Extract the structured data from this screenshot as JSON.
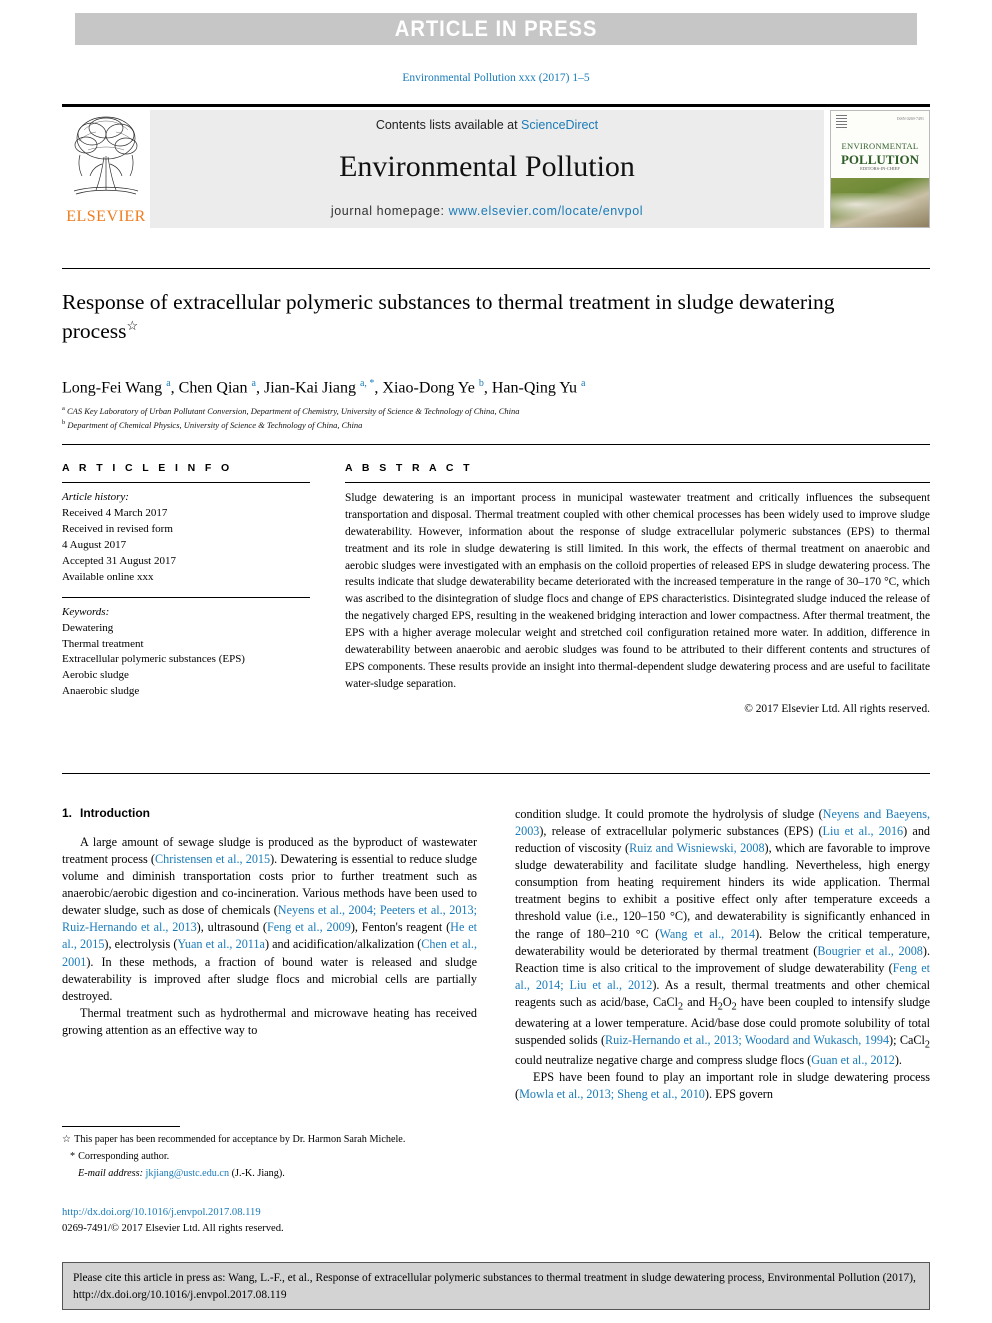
{
  "banner": {
    "text": "ARTICLE IN PRESS"
  },
  "running_head": "Environmental Pollution xxx (2017) 1–5",
  "masthead": {
    "contents_prefix": "Contents lists available at ",
    "contents_link": "ScienceDirect",
    "journal_name": "Environmental Pollution",
    "homepage_label": "journal homepage: ",
    "homepage_url": "www.elsevier.com/locate/envpol",
    "publisher_logo_text": "ELSEVIER",
    "cover": {
      "title_line1": "ENVIRONMENTAL",
      "title_line2": "POLLUTION",
      "subtitle": "EDITORS-IN-CHIEF",
      "issn": "ISSN 0269-7491"
    }
  },
  "article": {
    "title": "Response of extracellular polymeric substances to thermal treatment in sludge dewatering process",
    "title_footnote_marker": "☆",
    "authors_html": "Long-Fei Wang <sup>a</sup>, Chen Qian <sup>a</sup>, Jian-Kai Jiang <sup>a, *</sup>, Xiao-Dong Ye <sup>b</sup>, Han-Qing Yu <sup>a</sup>",
    "affiliations": [
      {
        "marker": "a",
        "text": "CAS Key Laboratory of Urban Pollutant Conversion, Department of Chemistry, University of Science & Technology of China, China"
      },
      {
        "marker": "b",
        "text": "Department of Chemical Physics, University of Science & Technology of China, China"
      }
    ]
  },
  "article_info": {
    "heading": "A R T I C L E   I N F O",
    "history_label": "Article history:",
    "history": [
      "Received 4 March 2017",
      "Received in revised form",
      "4 August 2017",
      "Accepted 31 August 2017",
      "Available online xxx"
    ],
    "keywords_label": "Keywords:",
    "keywords": [
      "Dewatering",
      "Thermal treatment",
      "Extracellular polymeric substances (EPS)",
      "Aerobic sludge",
      "Anaerobic sludge"
    ]
  },
  "abstract": {
    "heading": "A B S T R A C T",
    "text": "Sludge dewatering is an important process in municipal wastewater treatment and critically influences the subsequent transportation and disposal. Thermal treatment coupled with other chemical processes has been widely used to improve sludge dewaterability. However, information about the response of sludge extracellular polymeric substances (EPS) to thermal treatment and its role in sludge dewatering is still limited. In this work, the effects of thermal treatment on anaerobic and aerobic sludges were investigated with an emphasis on the colloid properties of released EPS in sludge dewatering process. The results indicate that sludge dewaterability became deteriorated with the increased temperature in the range of 30–170 °C, which was ascribed to the disintegration of sludge flocs and change of EPS characteristics. Disintegrated sludge induced the release of the negatively charged EPS, resulting in the weakened bridging interaction and lower compactness. After thermal treatment, the EPS with a higher average molecular weight and stretched coil configuration retained more water. In addition, difference in dewaterability between anaerobic and aerobic sludges was found to be attributed to their different contents and structures of EPS components. These results provide an insight into thermal-dependent sludge dewatering process and are useful to facilitate water-sludge separation.",
    "copyright": "© 2017 Elsevier Ltd. All rights reserved."
  },
  "body": {
    "section_number": "1.",
    "section_title": "Introduction",
    "left_paragraphs_html": [
      "A large amount of sewage sludge is produced as the byproduct of wastewater treatment process (<span class=\"cite\">Christensen et al., 2015</span>). Dewatering is essential to reduce sludge volume and diminish transportation costs prior to further treatment such as anaerobic/aerobic digestion and co-incineration. Various methods have been used to dewater sludge, such as dose of chemicals (<span class=\"cite\">Neyens et al., 2004; Peeters et al., 2013; Ruiz-Hernando et al., 2013</span>), ultrasound (<span class=\"cite\">Feng et al., 2009</span>), Fenton's reagent (<span class=\"cite\">He et al., 2015</span>), electrolysis (<span class=\"cite\">Yuan et al., 2011a</span>) and acidification/alkalization (<span class=\"cite\">Chen et al., 2001</span>). In these methods, a fraction of bound water is released and sludge dewaterability is improved after sludge flocs and microbial cells are partially destroyed.",
      "Thermal treatment such as hydrothermal and microwave heating has received growing attention as an effective way to"
    ],
    "right_paragraphs_html": [
      "condition sludge. It could promote the hydrolysis of sludge (<span class=\"cite\">Neyens and Baeyens, 2003</span>), release of extracellular polymeric substances (EPS) (<span class=\"cite\">Liu et al., 2016</span>) and reduction of viscosity (<span class=\"cite\">Ruiz and Wisniewski, 2008</span>), which are favorable to improve sludge dewaterability and facilitate sludge handling. Nevertheless, high energy consumption from heating requirement hinders its wide application. Thermal treatment begins to exhibit a positive effect only after temperature exceeds a threshold value (i.e., 120–150 °C), and dewaterability is significantly enhanced in the range of 180–210 °C (<span class=\"cite\">Wang et al., 2014</span>). Below the critical temperature, dewaterability would be deteriorated by thermal treatment (<span class=\"cite\">Bougrier et al., 2008</span>). Reaction time is also critical to the improvement of sludge dewaterability (<span class=\"cite\">Feng et al., 2014; Liu et al., 2012</span>). As a result, thermal treatments and other chemical reagents such as acid/base, CaCl<sub>2</sub> and H<sub>2</sub>O<sub>2</sub> have been coupled to intensify sludge dewatering at a lower temperature. Acid/base dose could promote solubility of total suspended solids (<span class=\"cite\">Ruiz-Hernando et al., 2013; Woodard and Wukasch, 1994</span>); CaCl<sub>2</sub> could neutralize negative charge and compress sludge flocs (<span class=\"cite\">Guan et al., 2012</span>).",
      "EPS have been found to play an important role in sludge dewatering process (<span class=\"cite\">Mowla et al., 2013; Sheng et al., 2010</span>). EPS govern"
    ]
  },
  "footnotes": {
    "star_symbol": "☆",
    "star_text": "This paper has been recommended for acceptance by Dr. Harmon Sarah Michele.",
    "corr_symbol": "*",
    "corr_text": "Corresponding author.",
    "email_label": "E-mail address:",
    "email": "jkjiang@ustc.edu.cn",
    "email_owner": "(J.-K. Jiang)."
  },
  "footer": {
    "doi_url": "http://dx.doi.org/10.1016/j.envpol.2017.08.119",
    "issn_line": "0269-7491/© 2017 Elsevier Ltd. All rights reserved."
  },
  "cite_box": {
    "text": "Please cite this article in press as: Wang, L.-F., et al., Response of extracellular polymeric substances to thermal treatment in sludge dewatering process, Environmental Pollution (2017), http://dx.doi.org/10.1016/j.envpol.2017.08.119"
  },
  "colors": {
    "link": "#1a7bb9",
    "banner_bg": "#c6c6c6",
    "panel_bg": "#ececec",
    "elsevier_orange": "#f07c1e",
    "cite_box_bg": "#d3d3d3"
  }
}
